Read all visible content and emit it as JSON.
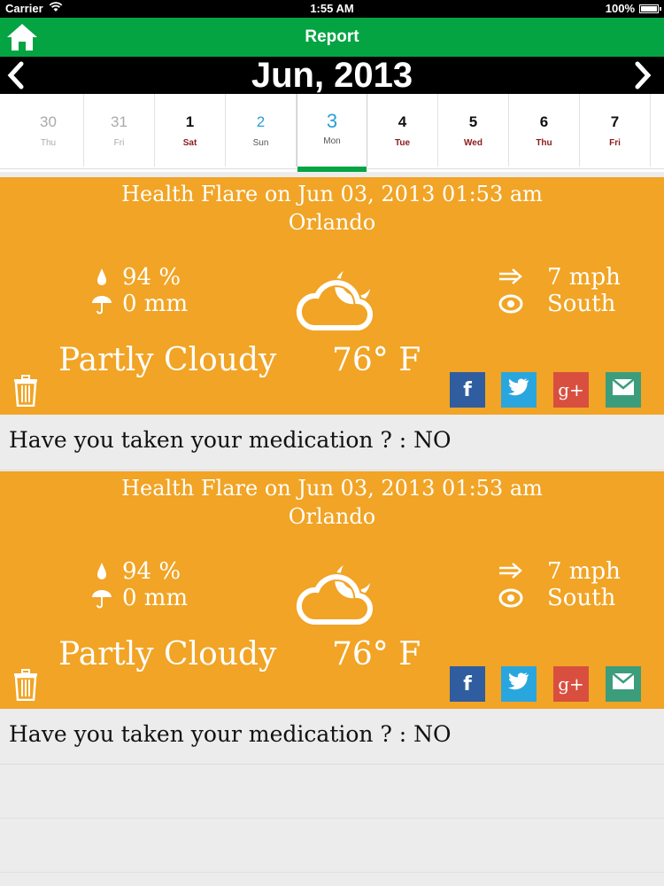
{
  "status": {
    "carrier": "Carrier",
    "time": "1:55 AM",
    "battery": "100%",
    "battery_level": 1.0
  },
  "nav": {
    "title": "Report"
  },
  "month": {
    "label": "Jun, 2013"
  },
  "days": [
    {
      "num": "30",
      "name": "Thu",
      "style": "muted"
    },
    {
      "num": "31",
      "name": "Fri",
      "style": "muted"
    },
    {
      "num": "1",
      "name": "Sat",
      "style": "normal"
    },
    {
      "num": "2",
      "name": "Sun",
      "style": "sun"
    },
    {
      "num": "3",
      "name": "Mon",
      "style": "selected"
    },
    {
      "num": "4",
      "name": "Tue",
      "style": "normal"
    },
    {
      "num": "5",
      "name": "Wed",
      "style": "normal"
    },
    {
      "num": "6",
      "name": "Thu",
      "style": "normal"
    },
    {
      "num": "7",
      "name": "Fri",
      "style": "normal"
    }
  ],
  "reports": [
    {
      "title": "Health Flare on Jun 03, 2013 01:53 am",
      "location": "Orlando",
      "humidity": "94 %",
      "precip": "0 mm",
      "wind": "7 mph",
      "direction": "South",
      "condition": "Partly Cloudy",
      "temp": "76° F",
      "question": "Have you taken your medication ? : NO"
    },
    {
      "title": "Health Flare on Jun 03, 2013 01:53 am",
      "location": "Orlando",
      "humidity": "94 %",
      "precip": "0 mm",
      "wind": "7 mph",
      "direction": "South",
      "condition": "Partly Cloudy",
      "temp": "76° F",
      "question": "Have you taken your medication ? : NO"
    }
  ],
  "social": {
    "facebook": {
      "glyph": "f",
      "color": "#2f5d9f"
    },
    "twitter": {
      "glyph": "t",
      "color": "#2aa6df"
    },
    "googleplus": {
      "glyph": "g+",
      "color": "#d94f3f"
    },
    "email": {
      "glyph": "email",
      "color": "#3c9d7d"
    }
  },
  "colors": {
    "nav_green": "#05a442",
    "card_orange": "#f1a425",
    "accent_blue": "#2a9fd6",
    "weekday_red": "#8b1a1a"
  }
}
